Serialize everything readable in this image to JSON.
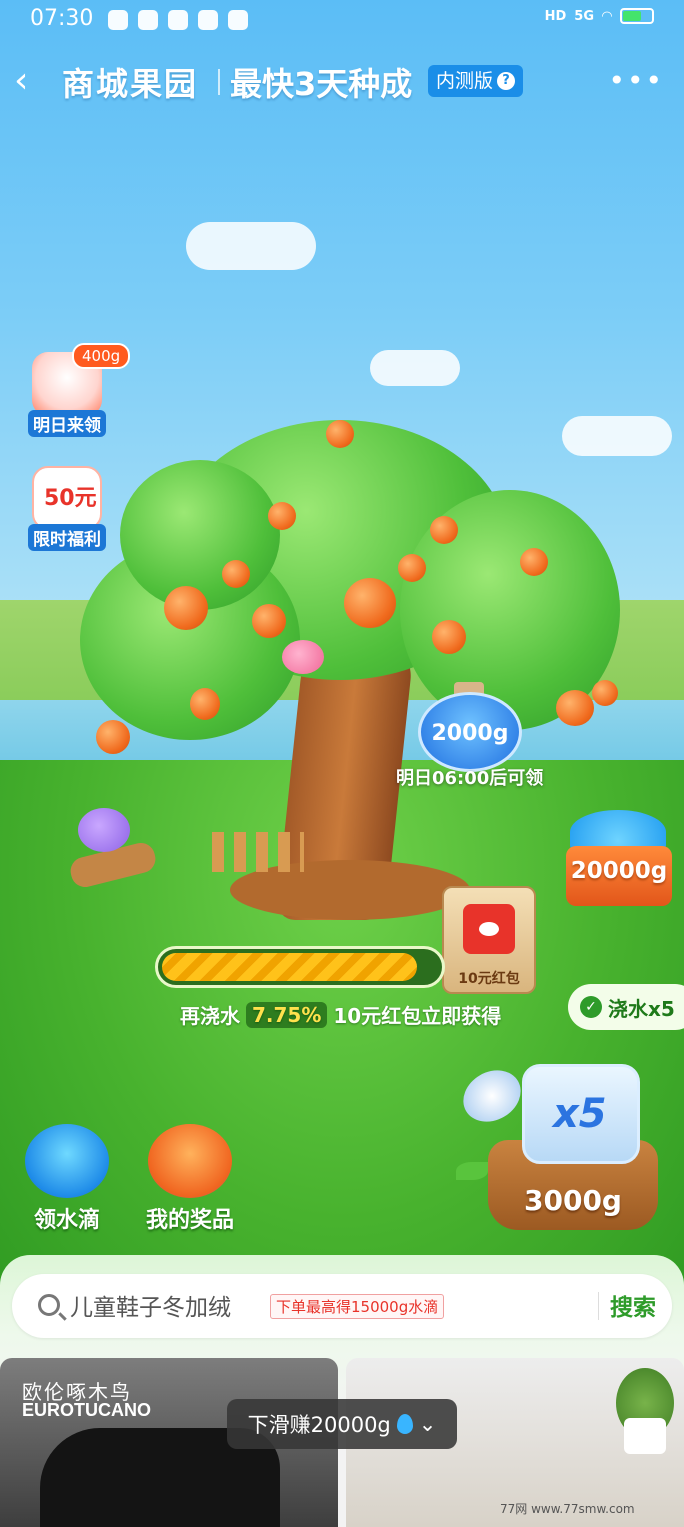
{
  "status_bar": {
    "time": "07:30",
    "network": "5G",
    "hd": "HD"
  },
  "header": {
    "back_icon": "back-arrow-icon",
    "title": "商城果园",
    "subtitle": "最快3天种成",
    "beta_label": "内测版",
    "help_icon": "question-icon",
    "more_icon": "more-dots-icon"
  },
  "left_widgets": {
    "tomorrow": {
      "badge": "400g",
      "label": "明日来领"
    },
    "welfare": {
      "amount": "50元",
      "label": "限时福利"
    }
  },
  "bottle": {
    "amount": "2000g",
    "note": "明日06:00后可领"
  },
  "reward_box": {
    "amount": "20000g"
  },
  "envelope": {
    "label": "10元红包"
  },
  "progress": {
    "percent": 0.9225,
    "prefix": "再浇水",
    "remaining": "7.75%",
    "suffix": "10元红包立即获得"
  },
  "water_pill": {
    "label": "浇水x5"
  },
  "watering_can": {
    "multiplier": "x5",
    "amount": "3000g"
  },
  "bottom_widgets": {
    "water_drops": "领水滴",
    "my_prizes": "我的奖品"
  },
  "search": {
    "query": "儿童鞋子冬加绒",
    "promo": "下单最高得15000g水滴",
    "button": "搜索"
  },
  "products": [
    {
      "brand_cn": "欧伦啄木鸟",
      "brand_en": "EUROTUCANO"
    },
    {
      "brand_cn": "",
      "brand_en": ""
    }
  ],
  "toast": {
    "text": "下滑赚20000g"
  },
  "watermark": "77网 www.77smw.com",
  "colors": {
    "accent": "#2e9b2a",
    "primary_blue": "#1c77d6",
    "promo_red": "#e8332a"
  }
}
